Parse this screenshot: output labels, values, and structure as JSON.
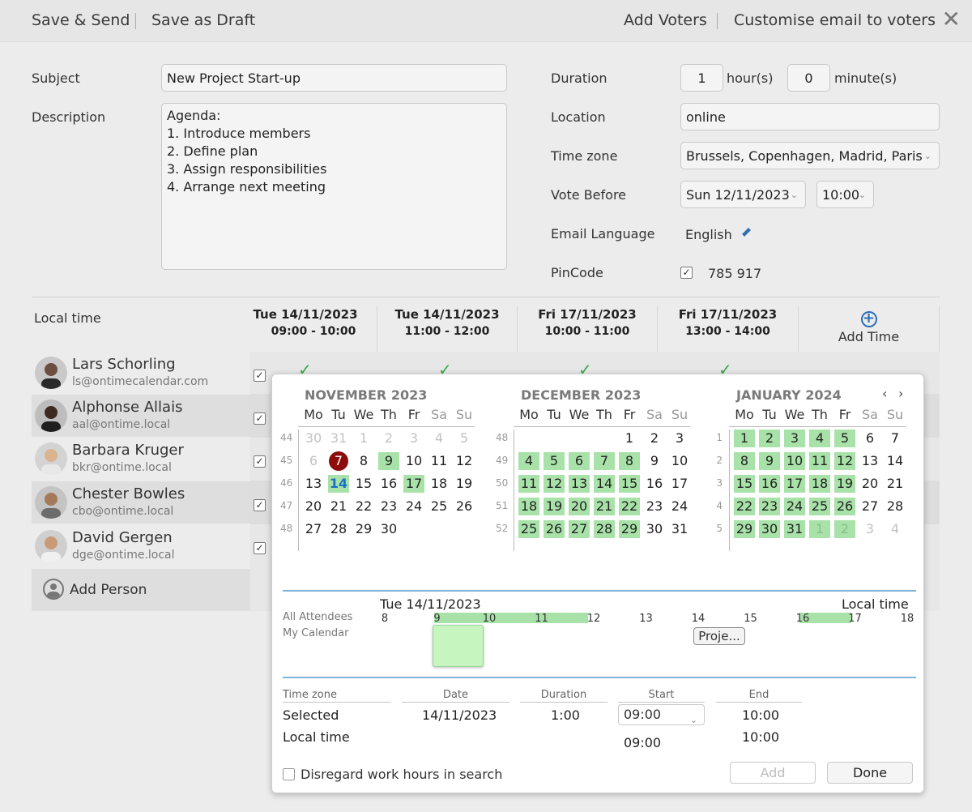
{
  "toolbar": {
    "save_send": "Save & Send",
    "save_draft": "Save as Draft",
    "add_voters": "Add Voters",
    "customise_email": "Customise email to voters",
    "close": "✕"
  },
  "form": {
    "subject_label": "Subject",
    "subject_value": "New Project Start-up",
    "description_label": "Description",
    "description_value": "Agenda:\n1. Introduce members\n2. Define plan\n3. Assign responsibilities\n4. Arrange next meeting",
    "duration_label": "Duration",
    "duration_hours": "1",
    "hours_unit": "hour(s)",
    "duration_minutes": "0",
    "minutes_unit": "minute(s)",
    "location_label": "Location",
    "location_value": "online",
    "timezone_label": "Time zone",
    "timezone_value": "Brussels, Copenhagen, Madrid, Paris",
    "vote_before_label": "Vote Before",
    "vote_before_date": "Sun 12/11/2023",
    "vote_before_time": "10:00",
    "email_language_label": "Email Language",
    "email_language_value": "English",
    "pincode_label": "PinCode",
    "pincode_checked": true,
    "pincode_value": "785 917"
  },
  "grid": {
    "local_time_label": "Local time",
    "columns": [
      {
        "date": "Tue 14/11/2023",
        "time": "09:00 - 10:00"
      },
      {
        "date": "Tue 14/11/2023",
        "time": "11:00 - 12:00"
      },
      {
        "date": "Fri 17/11/2023",
        "time": "10:00 - 11:00"
      },
      {
        "date": "Fri 17/11/2023",
        "time": "13:00 - 14:00"
      }
    ],
    "add_time_label": "Add Time",
    "people": [
      {
        "name": "Lars Schorling",
        "email": "ls@ontimecalendar.com",
        "checked": true
      },
      {
        "name": "Alphonse Allais",
        "email": "aal@ontime.local",
        "checked": true
      },
      {
        "name": "Barbara Kruger",
        "email": "bkr@ontime.local",
        "checked": true
      },
      {
        "name": "Chester Bowles",
        "email": "cbo@ontime.local",
        "checked": true
      },
      {
        "name": "David Gergen",
        "email": "dge@ontime.local",
        "checked": true
      }
    ],
    "add_person_label": "Add Person"
  },
  "picker": {
    "weekday_headers": [
      "Mo",
      "Tu",
      "We",
      "Th",
      "Fr",
      "Sa",
      "Su"
    ],
    "months": [
      {
        "title": "NOVEMBER 2023",
        "weeks": [
          "44",
          "45",
          "46",
          "47",
          "48"
        ],
        "rows": [
          [
            "30",
            "31",
            "1",
            "2",
            "3",
            "4",
            "5"
          ],
          [
            "6",
            "7",
            "8",
            "9",
            "10",
            "11",
            "12"
          ],
          [
            "13",
            "14",
            "15",
            "16",
            "17",
            "18",
            "19"
          ],
          [
            "20",
            "21",
            "22",
            "23",
            "24",
            "25",
            "26"
          ],
          [
            "27",
            "28",
            "29",
            "30",
            "",
            "",
            ""
          ]
        ],
        "styles": [
          [
            "f",
            "f",
            "f",
            "f",
            "f",
            "f",
            "f"
          ],
          [
            "f",
            "t",
            "",
            "g",
            "",
            "",
            ""
          ],
          [
            "",
            "s",
            "",
            "",
            "g",
            "",
            ""
          ],
          [
            "",
            "",
            "",
            "",
            "",
            "",
            ""
          ],
          [
            "",
            "",
            "",
            "",
            "",
            "",
            ""
          ]
        ]
      },
      {
        "title": "DECEMBER 2023",
        "weeks": [
          "48",
          "49",
          "50",
          "51",
          "52"
        ],
        "rows": [
          [
            "",
            "",
            "",
            "",
            "1",
            "2",
            "3"
          ],
          [
            "4",
            "5",
            "6",
            "7",
            "8",
            "9",
            "10"
          ],
          [
            "11",
            "12",
            "13",
            "14",
            "15",
            "16",
            "17"
          ],
          [
            "18",
            "19",
            "20",
            "21",
            "22",
            "23",
            "24"
          ],
          [
            "25",
            "26",
            "27",
            "28",
            "29",
            "30",
            "31"
          ]
        ],
        "styles": [
          [
            "",
            "",
            "",
            "",
            "",
            "",
            ""
          ],
          [
            "g",
            "g",
            "g",
            "g",
            "g",
            "",
            ""
          ],
          [
            "g",
            "g",
            "g",
            "g",
            "g",
            "",
            ""
          ],
          [
            "g",
            "g",
            "g",
            "g",
            "g",
            "",
            ""
          ],
          [
            "g",
            "g",
            "g",
            "g",
            "g",
            "",
            ""
          ]
        ]
      },
      {
        "title": "JANUARY 2024",
        "weeks": [
          "1",
          "2",
          "3",
          "4",
          "5"
        ],
        "rows": [
          [
            "1",
            "2",
            "3",
            "4",
            "5",
            "6",
            "7"
          ],
          [
            "8",
            "9",
            "10",
            "11",
            "12",
            "13",
            "14"
          ],
          [
            "15",
            "16",
            "17",
            "18",
            "19",
            "20",
            "21"
          ],
          [
            "22",
            "23",
            "24",
            "25",
            "26",
            "27",
            "28"
          ],
          [
            "29",
            "30",
            "31",
            "1",
            "2",
            "3",
            "4"
          ]
        ],
        "styles": [
          [
            "g",
            "g",
            "g",
            "g",
            "g",
            "",
            ""
          ],
          [
            "g",
            "g",
            "g",
            "g",
            "g",
            "",
            ""
          ],
          [
            "g",
            "g",
            "g",
            "g",
            "g",
            "",
            ""
          ],
          [
            "g",
            "g",
            "g",
            "g",
            "g",
            "",
            ""
          ],
          [
            "g",
            "g",
            "g",
            "gf",
            "gf",
            "f",
            "f"
          ]
        ]
      }
    ],
    "timeline": {
      "date": "Tue 14/11/2023",
      "local_time_label": "Local time",
      "all_attendees_label": "All Attendees",
      "my_calendar_label": "My Calendar",
      "hours": [
        "8",
        "9",
        "10",
        "11",
        "12",
        "13",
        "14",
        "15",
        "16",
        "17",
        "18"
      ],
      "event_label": "Proje..."
    },
    "bottom": {
      "headers": {
        "timezone": "Time zone",
        "date": "Date",
        "duration": "Duration",
        "start": "Start",
        "end": "End"
      },
      "selected_label": "Selected",
      "selected_date": "14/11/2023",
      "selected_duration": "1:00",
      "selected_start": "09:00",
      "selected_end": "10:00",
      "local_label": "Local time",
      "local_start": "09:00",
      "local_end": "10:00"
    },
    "disregard_label": "Disregard work hours in search",
    "add_button": "Add",
    "done_button": "Done"
  }
}
